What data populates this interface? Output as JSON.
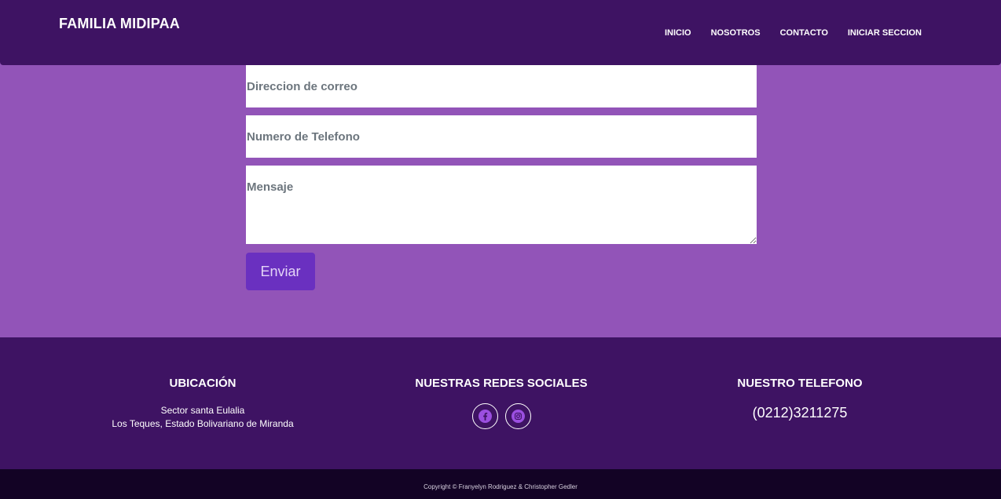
{
  "navbar": {
    "brand": "FAMILIA MIDIPAA",
    "links": [
      "INICIO",
      "NOSOTROS",
      "CONTACTO",
      "INICIAR SECCION"
    ]
  },
  "form": {
    "email_placeholder": "Direccion de correo",
    "phone_placeholder": "Numero de Telefono",
    "message_placeholder": "Mensaje",
    "submit_label": "Enviar"
  },
  "footer": {
    "location": {
      "heading": "UBICACIÓN",
      "line1": "Sector santa Eulalia",
      "line2": "Los Teques, Estado Bolivariano de Miranda"
    },
    "social": {
      "heading": "NUESTRAS REDES SOCIALES",
      "icons": [
        "facebook-icon",
        "instagram-icon"
      ]
    },
    "phone": {
      "heading": "NUESTRO TELEFONO",
      "number": "(0212)3211275"
    }
  },
  "copyright": "Copyright © Franyelyn Rodriguez & Christopher Gedler",
  "colors": {
    "primary_dark": "#3e1363",
    "page_background": "#9254b8",
    "button": "#6a30c0",
    "icon_accent": "#9b4fe0",
    "bottom_bar": "#130325"
  }
}
